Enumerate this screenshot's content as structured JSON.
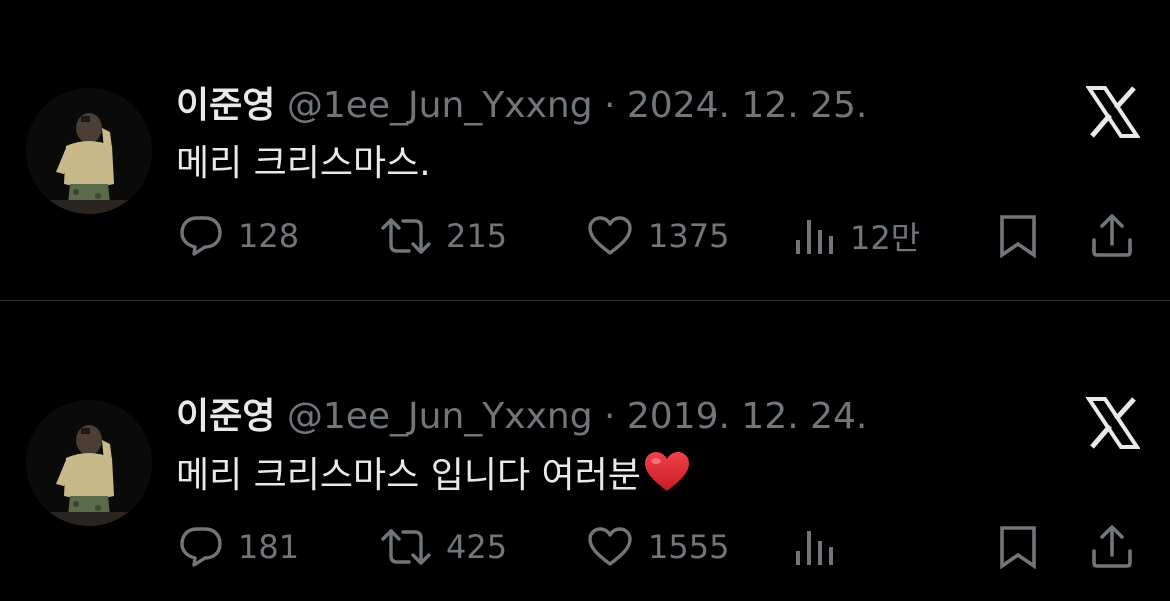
{
  "colors": {
    "background": "#000000",
    "primary_text": "#e7e9ea",
    "secondary_text": "#71767b",
    "divider": "#2f3336",
    "heart_emoji": "#e3262f"
  },
  "tweets": [
    {
      "display_name": "이준영",
      "handle": "@1ee_Jun_Yxxng",
      "separator": "·",
      "date": "2024. 12. 25.",
      "text": "메리 크리스마스.",
      "emoji": "",
      "replies": "128",
      "retweets": "215",
      "likes": "1375",
      "views": "12만",
      "icons": [
        "reply-icon",
        "retweet-icon",
        "like-icon",
        "views-icon",
        "bookmark-icon",
        "share-icon",
        "x-logo-icon"
      ]
    },
    {
      "display_name": "이준영",
      "handle": "@1ee_Jun_Yxxng",
      "separator": "·",
      "date": "2019. 12. 24.",
      "text": "메리 크리스마스 입니다 여러분",
      "emoji": "red-heart-emoji",
      "replies": "181",
      "retweets": "425",
      "likes": "1555",
      "views": "",
      "icons": [
        "reply-icon",
        "retweet-icon",
        "like-icon",
        "views-icon",
        "bookmark-icon",
        "share-icon",
        "x-logo-icon"
      ]
    }
  ]
}
